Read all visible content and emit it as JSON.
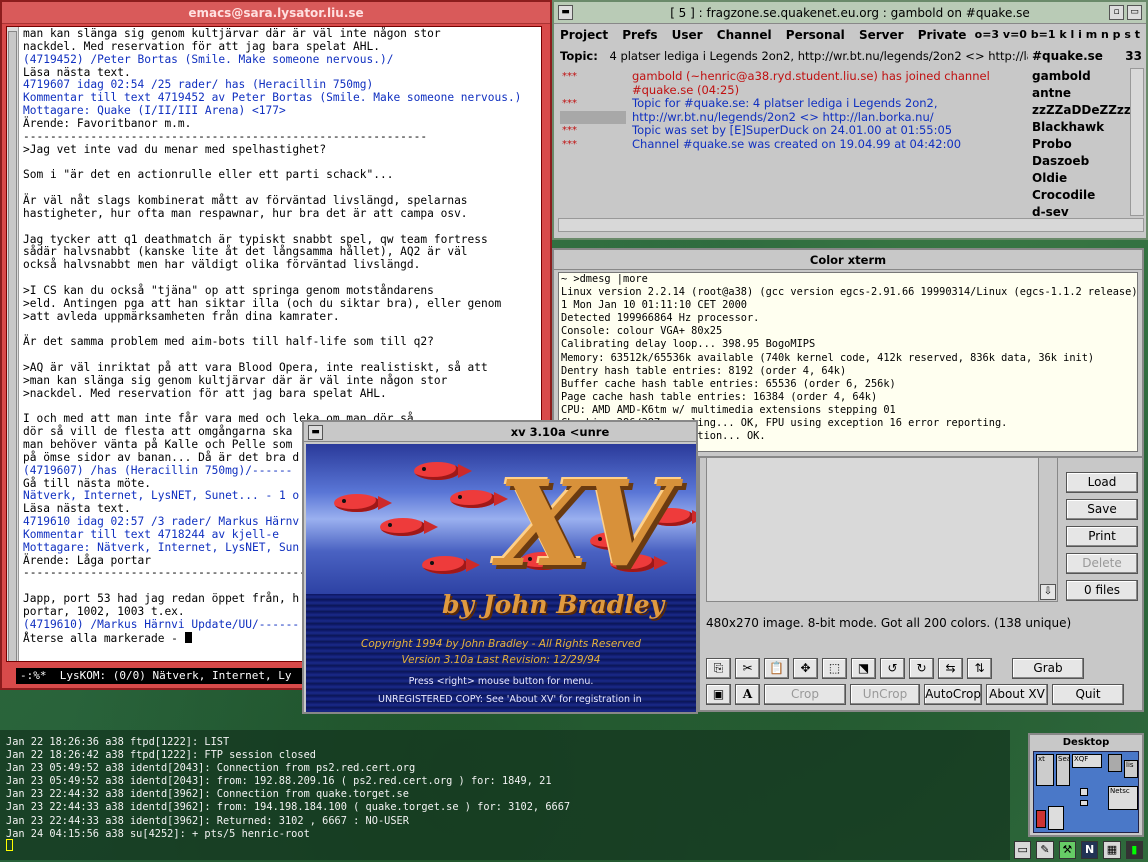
{
  "emacs": {
    "title": "emacs@sara.lysator.liu.se",
    "lines": [
      {
        "t": "man kan slänga sig genom kultjärvar där är väl inte någon stor",
        "c": ""
      },
      {
        "t": "nackdel. Med reservation för att jag bara spelat AHL.",
        "c": ""
      },
      {
        "t": "(4719452) /Peter Bortas (Smile. Make someone nervous.)/",
        "c": "blue"
      },
      {
        "t": "Läsa nästa text.",
        "c": ""
      },
      {
        "t": "4719607 idag 02:54 /25 rader/ has (Heracillin 750mg)",
        "c": "blue"
      },
      {
        "t": "Kommentar till text 4719452 av Peter Bortas (Smile. Make someone nervous.)",
        "c": "blue"
      },
      {
        "t": "Mottagare: Quake (I/II/III Arena) <177>",
        "c": "blue"
      },
      {
        "t": "Ärende: Favoritbanor m.m.",
        "c": ""
      },
      {
        "t": "------------------------------------------------------------",
        "c": ""
      },
      {
        "t": ">Jag vet inte vad du menar med spelhastighet?",
        "c": ""
      },
      {
        "t": "",
        "c": ""
      },
      {
        "t": "Som i \"är det en actionrulle eller ett parti schack\"...",
        "c": ""
      },
      {
        "t": "",
        "c": ""
      },
      {
        "t": "Är väl nåt slags kombinerat mått av förväntad livslängd, spelarnas",
        "c": ""
      },
      {
        "t": "hastigheter, hur ofta man respawnar, hur bra det är att campa osv.",
        "c": ""
      },
      {
        "t": "",
        "c": ""
      },
      {
        "t": "Jag tycker att q1 deathmatch är typiskt snabbt spel, qw team fortress",
        "c": ""
      },
      {
        "t": "sådär halvsnabbt (kanske lite åt det långsamma hållet), AQ2 är väl",
        "c": ""
      },
      {
        "t": "också halvsnabbt men har väldigt olika förväntad livslängd.",
        "c": ""
      },
      {
        "t": "",
        "c": ""
      },
      {
        "t": ">I CS kan du också \"tjäna\" op att springa genom motståndarens",
        "c": ""
      },
      {
        "t": ">eld. Antingen pga att han siktar illa (och du siktar bra), eller genom",
        "c": ""
      },
      {
        "t": ">att avleda uppmärksamheten från dina kamrater.",
        "c": ""
      },
      {
        "t": "",
        "c": ""
      },
      {
        "t": "Är det samma problem med aim-bots till half-life som till q2?",
        "c": ""
      },
      {
        "t": "",
        "c": ""
      },
      {
        "t": ">AQ är väl inriktat på att vara Blood Opera, inte realistiskt, så att",
        "c": ""
      },
      {
        "t": ">man kan slänga sig genom kultjärvar där är väl inte någon stor",
        "c": ""
      },
      {
        "t": ">nackdel. Med reservation för att jag bara spelat AHL.",
        "c": ""
      },
      {
        "t": "",
        "c": ""
      },
      {
        "t": "I och med att man inte får vara med och leka om man dör så",
        "c": ""
      },
      {
        "t": "dör så vill de flesta att omgångarna ska",
        "c": ""
      },
      {
        "t": "man behöver vänta på Kalle och Pelle som",
        "c": ""
      },
      {
        "t": "på ömse sidor av banan... Då är det bra d",
        "c": ""
      },
      {
        "t": "(4719607) /has (Heracillin 750mg)/------",
        "c": "blue"
      },
      {
        "t": "Gå till nästa möte.",
        "c": ""
      },
      {
        "t": "Nätverk, Internet, LysNET, Sunet... - 1 o",
        "c": "blue"
      },
      {
        "t": "Läsa nästa text.",
        "c": ""
      },
      {
        "t": "4719610 idag 02:57 /3 rader/ Markus Härnv",
        "c": "blue"
      },
      {
        "t": "Kommentar till text 4718244 av kjell-e",
        "c": "blue"
      },
      {
        "t": "Mottagare: Nätverk, Internet, LysNET, Sun",
        "c": "blue"
      },
      {
        "t": "Ärende: Låga portar",
        "c": ""
      },
      {
        "t": "------------------------------------------",
        "c": ""
      },
      {
        "t": "",
        "c": ""
      },
      {
        "t": "Japp, port 53 had jag redan öppet från, h",
        "c": ""
      },
      {
        "t": "portar, 1002, 1003 t.ex.",
        "c": ""
      },
      {
        "t": "(4719610) /Markus Härnvi Update/UU/------",
        "c": "blue"
      },
      {
        "t": "Återse alla markerade - ",
        "c": ""
      }
    ],
    "modeline": "-:%*  LysKOM: (0/0) Nätverk, Internet, Ly"
  },
  "irc": {
    "title": "[ 5 ] : fragzone.se.quakenet.eu.org : gambold on #quake.se",
    "menu": [
      "Project",
      "Prefs",
      "User",
      "Channel",
      "Personal",
      "Server",
      "Private"
    ],
    "modes": "o=3  v=0  b=1  k l i m n p s t",
    "topic_label": "Topic:",
    "topic": "4 platser lediga i Legends 2on2, http://wr.bt.nu/legends/2on2 <>  http://lan",
    "channel": "#quake.se",
    "user_count": "33",
    "log": [
      {
        "star": "***",
        "msg": "gambold (~henric@a38.ryd.student.liu.se) has joined channel",
        "color": "#c01010"
      },
      {
        "star": "",
        "msg": "#quake.se (04:25)",
        "color": "#c01010"
      },
      {
        "star": "***",
        "msg": "Topic for #quake.se: 4 platser lediga i Legends 2on2,",
        "color": "#1030c0"
      },
      {
        "star": "",
        "msg": "http://wr.bt.nu/legends/2on2 <>  http://lan.borka.nu/",
        "color": "#1030c0"
      },
      {
        "star": "***",
        "msg": "Topic was set by [E]SuperDuck on 24.01.00 at 01:55:05",
        "color": "#1030c0"
      },
      {
        "star": "***",
        "msg": "Channel #quake.se was created on 19.04.99 at 04:42:00",
        "color": "#1030c0"
      }
    ],
    "users": [
      "gambold",
      "antne",
      "zzZZaDDeZZzz",
      "Blackhawk",
      "Probo",
      "Daszoeb",
      "Oldie",
      "Crocodile",
      "d-sev"
    ]
  },
  "xterm": {
    "title": "Color xterm",
    "lines": [
      "~ >dmesg |more",
      "Linux version 2.2.14 (root@a38) (gcc version egcs-2.91.66 19990314/Linux (egcs-1.1.2 release)) #",
      "1 Mon Jan 10 01:11:10 CET 2000",
      "Detected 199966864 Hz processor.",
      "Console: colour VGA+ 80x25",
      "Calibrating delay loop... 398.95 BogoMIPS",
      "Memory: 63512k/65536k available (740k kernel code, 412k reserved, 836k data, 36k init)",
      "Dentry hash table entries: 8192 (order 4, 64k)",
      "Buffer cache hash table entries: 65536 (order 6, 256k)",
      "Page cache hash table entries: 16384 (order 4, 64k)",
      "CPU: AMD AMD-K6tm w/ multimedia extensions stepping 01",
      "Checking 386/387 coupling... OK, FPU using exception 16 error reporting.",
      "Checking 'hlt' instruction... OK.",
      "--More--"
    ]
  },
  "xvimg": {
    "title": "xv 3.10a <unre",
    "byline": "by John Bradley",
    "copyright": "Copyright 1994 by John Bradley - All Rights Reserved",
    "version": "Version 3.10a     Last Revision: 12/29/94",
    "press": "Press <right> mouse button for menu.",
    "unregistered": "UNREGISTERED COPY:  See 'About XV' for registration in"
  },
  "xvctrl": {
    "side_buttons": [
      {
        "label": "Load",
        "disabled": false
      },
      {
        "label": "Save",
        "disabled": false
      },
      {
        "label": "Print",
        "disabled": false
      },
      {
        "label": "Delete",
        "disabled": true
      },
      {
        "label": "0 files",
        "disabled": false
      }
    ],
    "status": "480x270 image.  8-bit mode.  Got all 200 colors.  (138 unique)",
    "row1_icons": [
      "⎘",
      "✂",
      "📋",
      "✥",
      "⬚",
      "⬔",
      "↺",
      "↻",
      "⇆",
      "⇅"
    ],
    "grab": "Grab",
    "row2": {
      "icon1": "▣",
      "icon2": "A",
      "crop": "Crop",
      "uncrop": "UnCrop",
      "autocrop": "AutoCrop",
      "about": "About XV",
      "quit": "Quit"
    }
  },
  "syslog": {
    "lines": [
      "Jan 22 18:26:36 a38 ftpd[1222]: LIST",
      "Jan 22 18:26:42 a38 ftpd[1222]: FTP session closed",
      "Jan 23 05:49:52 a38 identd[2043]: Connection from ps2.red.cert.org",
      "Jan 23 05:49:52 a38 identd[2043]: from: 192.88.209.16 ( ps2.red.cert.org ) for: 1849, 21",
      "Jan 23 22:44:32 a38 identd[3962]: Connection from quake.torget.se",
      "Jan 23 22:44:33 a38 identd[3962]: from: 194.198.184.100 ( quake.torget.se ) for: 3102, 6667",
      "Jan 23 22:44:33 a38 identd[3962]: Returned: 3102 , 6667 : NO-USER",
      "Jan 24 04:15:56 a38 su[4252]: + pts/5 henric-root"
    ]
  },
  "pager": {
    "title": "Desktop",
    "minis": [
      "xt",
      "Sea",
      "XQF",
      "Netsc",
      "lis"
    ]
  }
}
